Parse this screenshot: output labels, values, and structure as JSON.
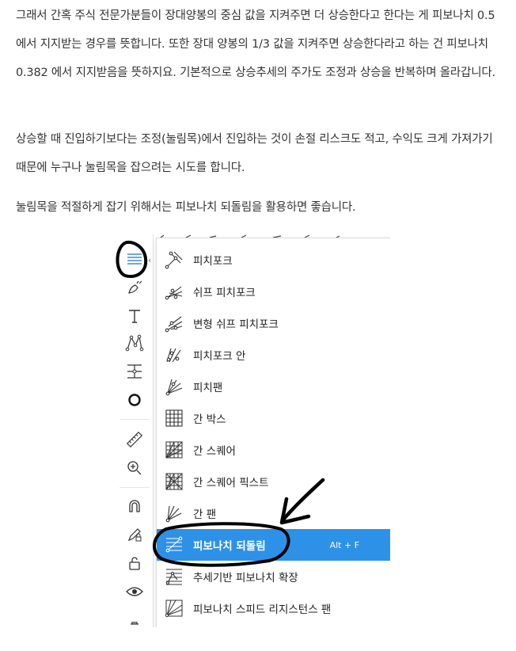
{
  "article": {
    "para1": "그래서 간혹 주식 전문가분들이 장대양봉의 중심 값을 지켜주면 더 상승한다고 한다는 게 피보나치 0.5 에서 지지받는 경우를 뜻합니다. 또한 장대 양봉의 1/3 값을 지켜주면 상승한다라고 하는 건 피보나치 0.382 에서 지지받음을 뜻하지요. 기본적으로 상승추세의 주가도 조정과 상승을 반복하며 올라갑니다.",
    "para2": "상승할 때 진입하기보다는 조정(눌림목)에서 진입하는 것이 손절 리스크도 적고, 수익도 크게 가져가기 때문에 누구나 눌림목을 잡으려는 시도를 합니다.",
    "para3": "눌림목을 적절하게 잡기 위해서는 피보나치 되돌림을 활용하면 좋습니다."
  },
  "menu": {
    "items": [
      {
        "label": "피치포크",
        "icon": "pitchfork-icon"
      },
      {
        "label": "쉬프 피치포크",
        "icon": "schiff-pitchfork-icon"
      },
      {
        "label": "변형 쉬프 피치포크",
        "icon": "modified-schiff-pitchfork-icon"
      },
      {
        "label": "피치포크 안",
        "icon": "inside-pitchfork-icon"
      },
      {
        "label": "피치팬",
        "icon": "pitchfan-icon"
      },
      {
        "label": "간 박스",
        "icon": "gann-box-icon"
      },
      {
        "label": "간 스퀘어",
        "icon": "gann-square-icon"
      },
      {
        "label": "간 스퀘어 픽스트",
        "icon": "gann-square-fixed-icon"
      },
      {
        "label": "간 팬",
        "icon": "gann-fan-icon"
      },
      {
        "label": "피보나치 되돌림",
        "icon": "fib-retracement-icon",
        "active": true,
        "shortcut": "Alt + F"
      },
      {
        "label": "추세기반 피보나치 확장",
        "icon": "trend-fib-extension-icon"
      },
      {
        "label": "피보나치 스피드 리지스턴스 팬",
        "icon": "fib-speed-fan-icon"
      }
    ]
  },
  "colors": {
    "active": "#2e91e8",
    "annotation": "#000000"
  }
}
